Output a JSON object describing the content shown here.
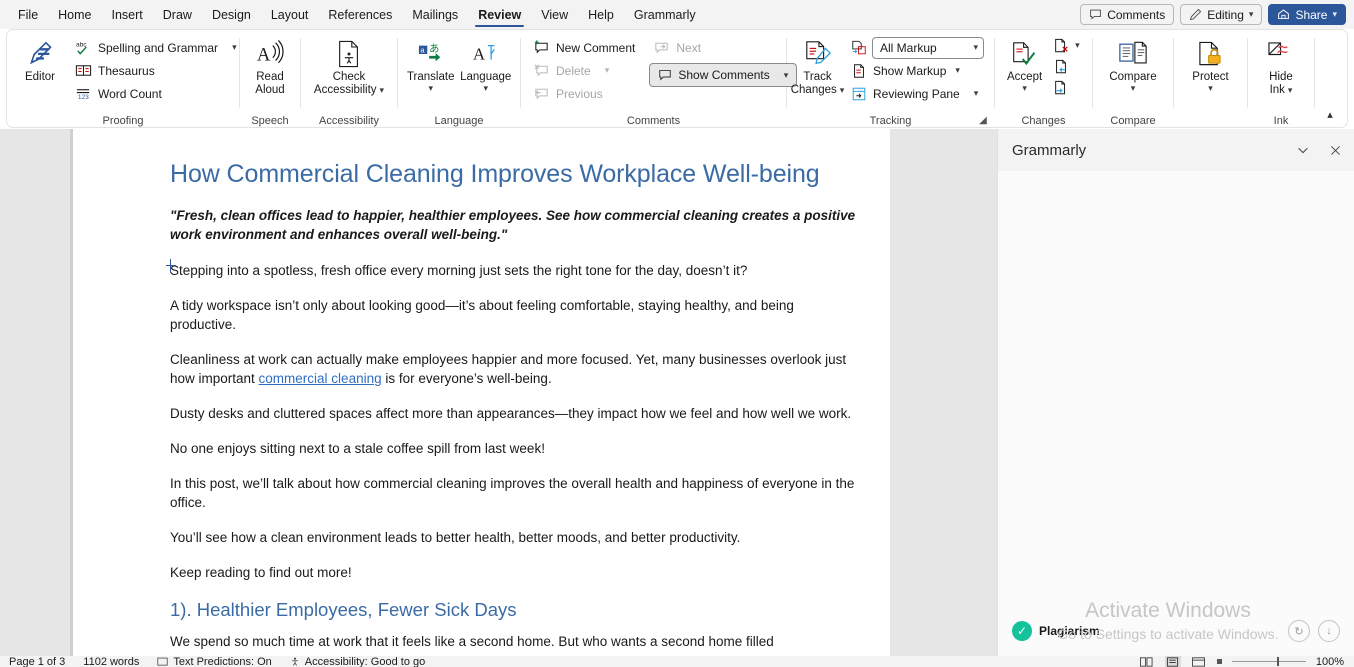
{
  "tabs": [
    {
      "label": "File",
      "active": false
    },
    {
      "label": "Home",
      "active": false
    },
    {
      "label": "Insert",
      "active": false
    },
    {
      "label": "Draw",
      "active": false
    },
    {
      "label": "Design",
      "active": false
    },
    {
      "label": "Layout",
      "active": false
    },
    {
      "label": "References",
      "active": false
    },
    {
      "label": "Mailings",
      "active": false
    },
    {
      "label": "Review",
      "active": true
    },
    {
      "label": "View",
      "active": false
    },
    {
      "label": "Help",
      "active": false
    },
    {
      "label": "Grammarly",
      "active": false
    }
  ],
  "titlebar": {
    "comments_label": "Comments",
    "editing_label": "Editing",
    "share_label": "Share"
  },
  "ribbon": {
    "groups": {
      "proofing": {
        "label": "Proofing",
        "editor": "Editor",
        "spelling_and_grammar": "Spelling and Grammar",
        "thesaurus": "Thesaurus",
        "word_count": "Word Count"
      },
      "speech": {
        "label": "Speech",
        "read_aloud_line1": "Read",
        "read_aloud_line2": "Aloud"
      },
      "accessibility": {
        "label": "Accessibility",
        "check_line1": "Check",
        "check_line2": "Accessibility"
      },
      "language": {
        "label": "Language",
        "translate": "Translate",
        "language": "Language"
      },
      "comments": {
        "label": "Comments",
        "new_comment": "New Comment",
        "delete": "Delete",
        "previous": "Previous",
        "next": "Next",
        "show_comments": "Show Comments"
      },
      "tracking": {
        "label": "Tracking",
        "track_line1": "Track",
        "track_line2": "Changes",
        "markup_value": "All Markup",
        "show_markup": "Show Markup",
        "reviewing_pane": "Reviewing Pane"
      },
      "changes": {
        "label": "Changes",
        "accept": "Accept"
      },
      "compare": {
        "label": "Compare",
        "compare": "Compare"
      },
      "protect": {
        "label": "",
        "protect": "Protect"
      },
      "ink": {
        "label": "Ink",
        "hide_line1": "Hide",
        "hide_line2": "Ink"
      }
    }
  },
  "document": {
    "title": "How Commercial Cleaning Improves Workplace Well-being",
    "lede": "\"Fresh, clean offices lead to happier, healthier employees. See how commercial cleaning creates a positive work environment and enhances overall well-being.\"",
    "paragraphs": [
      "Stepping into a spotless, fresh office every morning just sets the right tone for the day, doesn’t it?",
      "A tidy workspace isn’t only about looking good—it’s about feeling comfortable, staying healthy, and being productive."
    ],
    "para_link_before": "Cleanliness at work can actually make employees happier and more focused. Yet, many businesses overlook just how important ",
    "para_link_text": "commercial cleaning",
    "para_link_after": " is for everyone’s well-being.",
    "paragraphs2": [
      "Dusty desks and cluttered spaces affect more than appearances—they impact how we feel and how well we work.",
      "No one enjoys sitting next to a stale coffee spill from last week!",
      "In this post, we’ll talk about how commercial cleaning improves the overall health and happiness of everyone in the office.",
      "You’ll see how a clean environment leads to better health, better moods, and better productivity.",
      "Keep reading to find out more!"
    ],
    "heading2": "1). Healthier Employees, Fewer Sick Days",
    "clipped_line": "We spend so much time at work that it feels like a second home. But who wants a second home filled"
  },
  "grammarly": {
    "title": "Grammarly",
    "plagiarism_label": "Plagiarism"
  },
  "watermark": {
    "line1": "Activate Windows",
    "line2": "Go to Settings to activate Windows."
  },
  "statusbar": {
    "page": "Page 1 of 3",
    "words": "1102 words",
    "text_predictions": "Text Predictions: On",
    "accessibility": "Accessibility: Good to go",
    "zoom": "100%"
  },
  "colors": {
    "accent": "#2b579a",
    "heading": "#3a6ba5",
    "link": "#2f6fc4",
    "grammarly_green": "#15c39a"
  }
}
